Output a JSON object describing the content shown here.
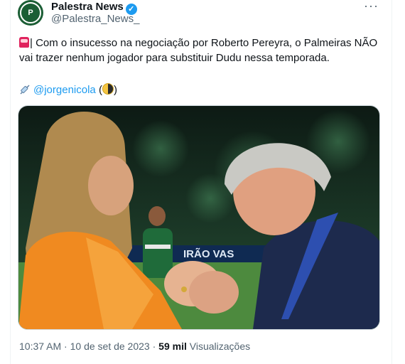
{
  "account": {
    "name": "Palestra News",
    "handle": "@Palestra_News_",
    "verified": true,
    "avatar_icon": "palmeiras-crest-icon"
  },
  "menu_icon": "more-options-icon",
  "tweet": {
    "text": "| Com o insucesso na negociação por Roberto Pereyra, o Palmeiras NÃO vai trazer nenhum jogador para substituir Dudu nessa temporada.",
    "leading_icon": "siren-icon",
    "credit_mention": "@jorgenicola",
    "credit_icon": "syringe-icon",
    "credit_suffix_open": "(",
    "credit_suffix_close": ")",
    "credit_emoji": "half-moon-icon",
    "photo_alt": "photo",
    "banner_text": "IRÃO VAS"
  },
  "meta": {
    "time": "10:37 AM",
    "separator": "·",
    "date": "10 de set de 2023",
    "views_count": "59 mil",
    "views_label": "Visualizações"
  },
  "colors": {
    "accent": "#1d9bf0",
    "text_primary": "#0f1419",
    "text_secondary": "#536471",
    "border": "#eff3f4"
  }
}
